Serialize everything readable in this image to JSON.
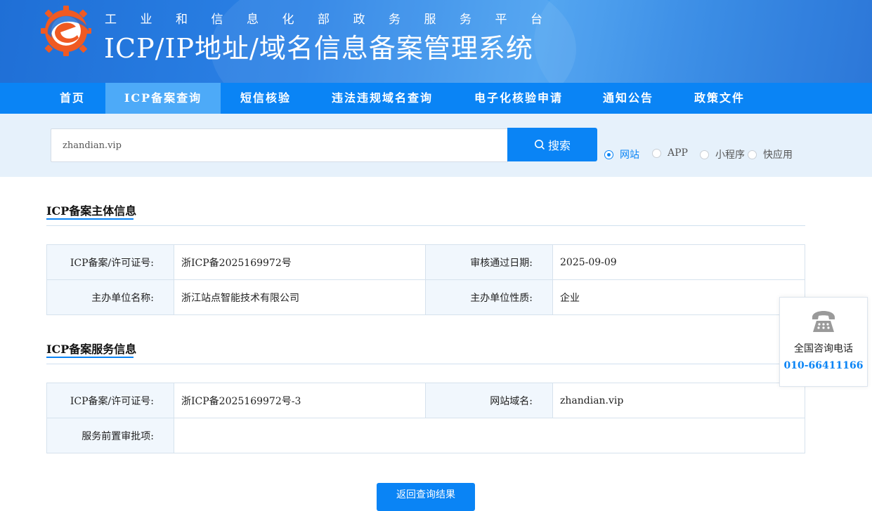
{
  "header": {
    "subtitle": [
      "工",
      "业",
      "和",
      "信",
      "息",
      "化",
      "部",
      "政",
      "务",
      "服",
      "务",
      "平",
      "台"
    ],
    "title": "ICP/IP地址/域名信息备案管理系统"
  },
  "nav": {
    "items": [
      {
        "label": "首页"
      },
      {
        "label": "ICP备案查询"
      },
      {
        "label": "短信核验"
      },
      {
        "label": "违法违规域名查询"
      },
      {
        "label": "电子化核验申请"
      },
      {
        "label": "通知公告"
      },
      {
        "label": "政策文件"
      }
    ],
    "active": "ICP备案查询"
  },
  "search": {
    "value": "zhandian.vip",
    "button_label": "搜索",
    "options": [
      {
        "label": "网站",
        "checked": true
      },
      {
        "label": "APP",
        "checked": false
      },
      {
        "label": "小程序",
        "checked": false
      },
      {
        "label": "快应用",
        "checked": false
      }
    ]
  },
  "subject_section": {
    "title": "ICP备案主体信息",
    "license_label": "ICP备案/许可证号:",
    "license_value": "浙ICP备2025169972号",
    "approve_date_label": "审核通过日期:",
    "approve_date_value": "2025-09-09",
    "org_name_label": "主办单位名称:",
    "org_name_value": "浙江站点智能技术有限公司",
    "org_type_label": "主办单位性质:",
    "org_type_value": "企业"
  },
  "service_section": {
    "title": "ICP备案服务信息",
    "license_label": "ICP备案/许可证号:",
    "license_value": "浙ICP备2025169972号-3",
    "domain_label": "网站域名:",
    "domain_value": "zhandian.vip",
    "preapproval_label": "服务前置审批项:",
    "preapproval_value": ""
  },
  "back_button_label": "返回查询结果",
  "consult": {
    "label": "全国咨询电话",
    "phone": "010-66411166"
  },
  "colors": {
    "primary": "#0a84f5",
    "nav_active": "#4daaf8",
    "search_band": "#e6f1fb",
    "logo_orange": "#f05a22"
  }
}
